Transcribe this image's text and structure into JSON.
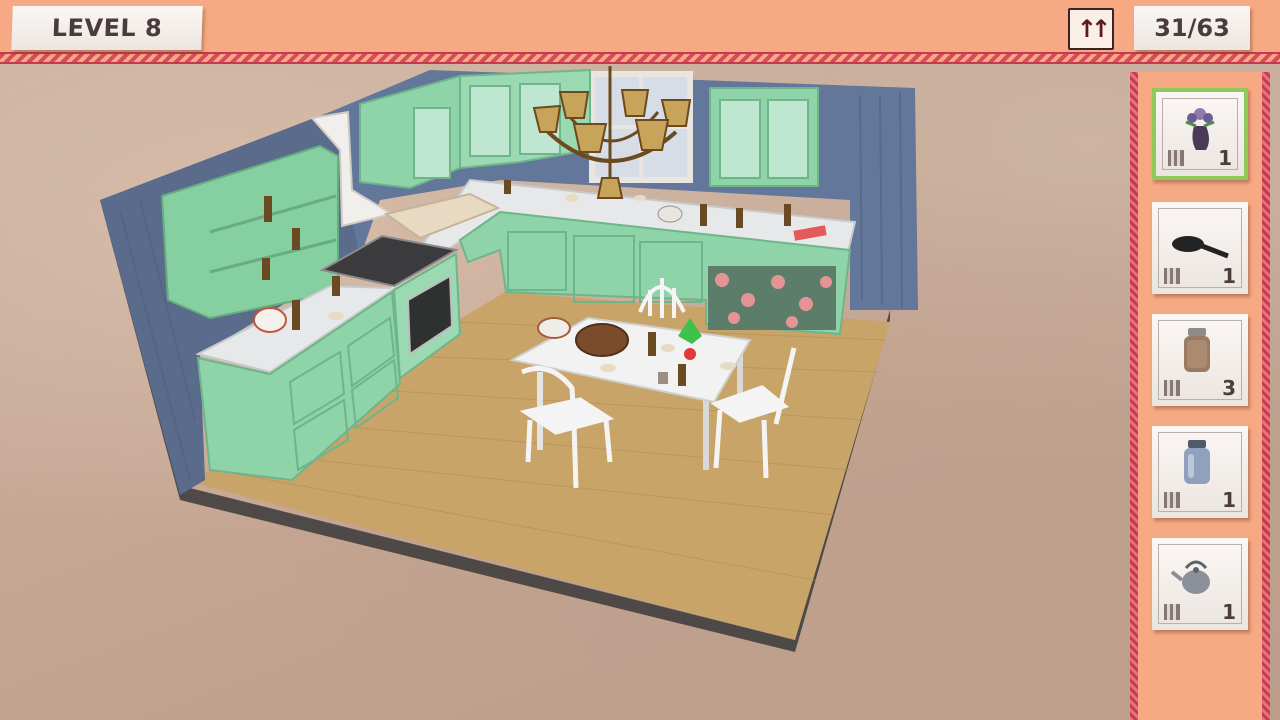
{
  "hud": {
    "level_label": "LEVEL 8",
    "found_counter": "31/63",
    "boost_icon": "double-up-arrow-icon"
  },
  "item_panel": {
    "items": [
      {
        "name": "flower vase",
        "icon": "flower-vase-icon",
        "count": "1",
        "selected": true
      },
      {
        "name": "frying pan",
        "icon": "frying-pan-icon",
        "count": "1",
        "selected": false
      },
      {
        "name": "cookie jar",
        "icon": "cookie-jar-icon",
        "count": "3",
        "selected": false
      },
      {
        "name": "glass jar",
        "icon": "glass-jar-icon",
        "count": "1",
        "selected": false
      },
      {
        "name": "kettle",
        "icon": "kettle-icon",
        "count": "1",
        "selected": false
      }
    ]
  },
  "colors": {
    "hud_orange": "#f6a982",
    "trim_red": "#d94b5c",
    "selected_green": "#8ec95a",
    "cabinet_mint": "#8fd3a8",
    "wall_blue": "#5d6f8e",
    "floor_wood": "#c9a468"
  }
}
